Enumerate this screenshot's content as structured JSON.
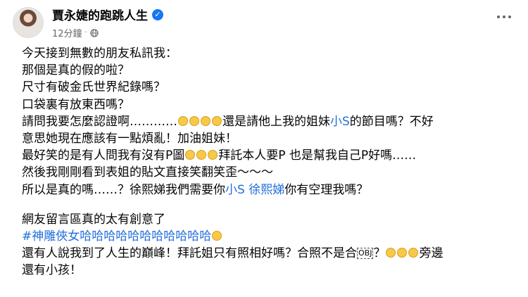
{
  "header": {
    "author": "賈永婕的跑跳人生",
    "timestamp": "12分鐘",
    "separator": "·",
    "verified_icon": "check-badge-icon",
    "privacy_icon": "globe-icon",
    "more_icon": "ellipsis-icon"
  },
  "post": {
    "l1": "今天接到無數的朋友私訊我：",
    "l2": "那個是真的假的啦？",
    "l3": "尺寸有破金氏世界紀錄嗎？",
    "l4": "口袋裏有放東西嗎？",
    "l5a": "請問我要怎麼認證啊…………",
    "l5b": "還是請他上我的姐妹",
    "l5_mention": "小S",
    "l5c": "的節目嗎？不好",
    "l6": "意思她現在應該有一點煩亂！加油姐妹！",
    "l7a": "最好笑的是有人問我有沒有P圖",
    "l7b": "拜託本人要P 也是幫我自己P好嗎……",
    "l8": "然後我剛剛看到表姐的貼文直接笑翻笑歪～～～",
    "l9a": "所以是真的嗎……？徐熙娣我們需要你",
    "l9_mention1": "小S",
    "l9_space": " ",
    "l9_mention2": "徐熙娣",
    "l9b": "你有空理我嗎？",
    "l10": "網友留言區真的太有創意了",
    "l11_hashtag": "#神雕俠女哈哈哈哈哈哈哈哈哈哈哈",
    "l12a": "還有人說我到了人生的巔峰！拜託姐只有照相好嗎？合照不是合",
    "l12_obj": "OBJ",
    "l12b": "？",
    "l12c": "旁邊",
    "l13": "還有小孩！"
  },
  "colors": {
    "link": "#216fdb",
    "text": "#050505",
    "meta": "#65676b",
    "verified": "#1877f2"
  }
}
